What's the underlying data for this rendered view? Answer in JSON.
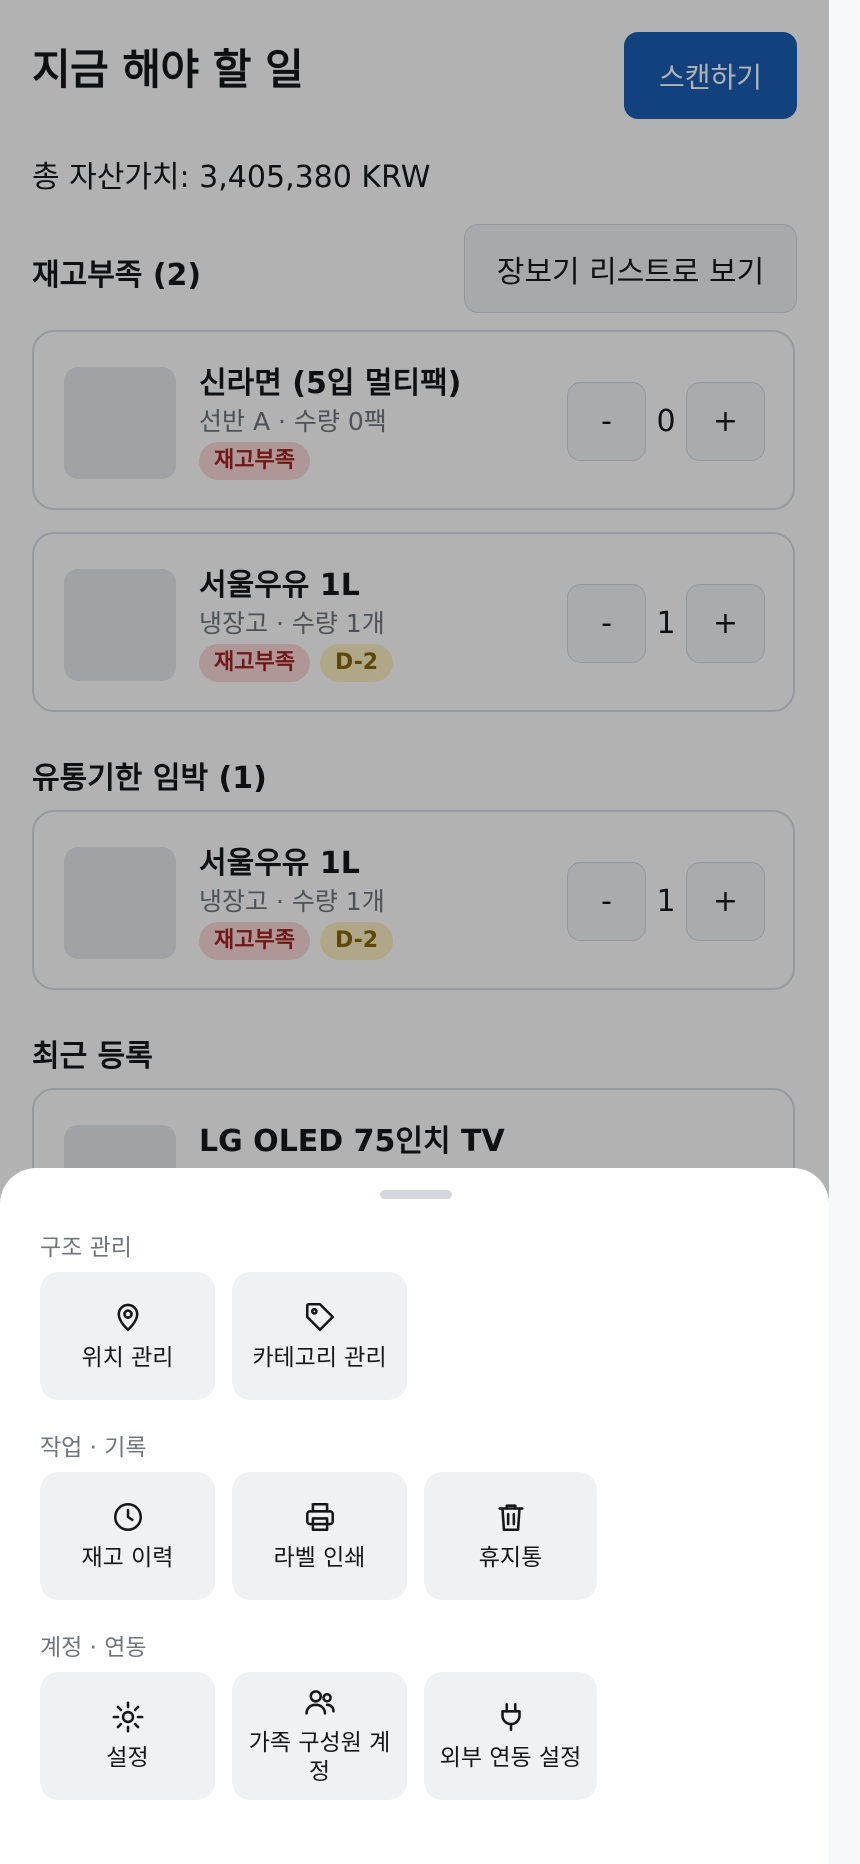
{
  "header": {
    "title": "지금 해야 할 일",
    "scan_label": "스캔하기"
  },
  "asset_value": "총 자산가치: 3,405,380 KRW",
  "sections": {
    "low_stock": {
      "title": "재고부족 (2)",
      "list_button": "장보기 리스트로 보기",
      "items": [
        {
          "name": "신라면 (5입 멀티팩)",
          "sub": "선반 A · 수량 0팩",
          "qty": "0",
          "badges": [
            "재고부족"
          ]
        },
        {
          "name": "서울우유 1L",
          "sub": "냉장고 · 수량 1개",
          "qty": "1",
          "badges": [
            "재고부족",
            "D-2"
          ]
        }
      ]
    },
    "expiring": {
      "title": "유통기한 임박 (1)",
      "items": [
        {
          "name": "서울우유 1L",
          "sub": "냉장고 · 수량 1개",
          "qty": "1",
          "badges": [
            "재고부족",
            "D-2"
          ]
        }
      ]
    },
    "recent": {
      "title": "최근 등록",
      "items": [
        {
          "name": "LG OLED 75인치 TV"
        }
      ]
    }
  },
  "stepper": {
    "minus": "-",
    "plus": "+"
  },
  "sheet": {
    "groups": [
      {
        "label": "구조 관리",
        "actions": [
          {
            "label": "위치 관리",
            "icon": "map-pin-icon"
          },
          {
            "label": "카테고리 관리",
            "icon": "tag-icon"
          }
        ]
      },
      {
        "label": "작업 · 기록",
        "actions": [
          {
            "label": "재고 이력",
            "icon": "clock-icon"
          },
          {
            "label": "라벨 인쇄",
            "icon": "printer-icon"
          },
          {
            "label": "휴지통",
            "icon": "trash-icon"
          }
        ]
      },
      {
        "label": "계정 · 연동",
        "actions": [
          {
            "label": "설정",
            "icon": "sun-settings-icon"
          },
          {
            "label": "가족 구성원 계정",
            "icon": "users-icon"
          },
          {
            "label": "외부 연동 설정",
            "icon": "plug-icon"
          }
        ]
      }
    ]
  },
  "colors": {
    "primary": "#1a5fb4",
    "badge_low_bg": "#fbd9d9",
    "badge_low_fg": "#a32222",
    "badge_exp_bg": "#fdf0c4",
    "badge_exp_fg": "#8a6606"
  }
}
